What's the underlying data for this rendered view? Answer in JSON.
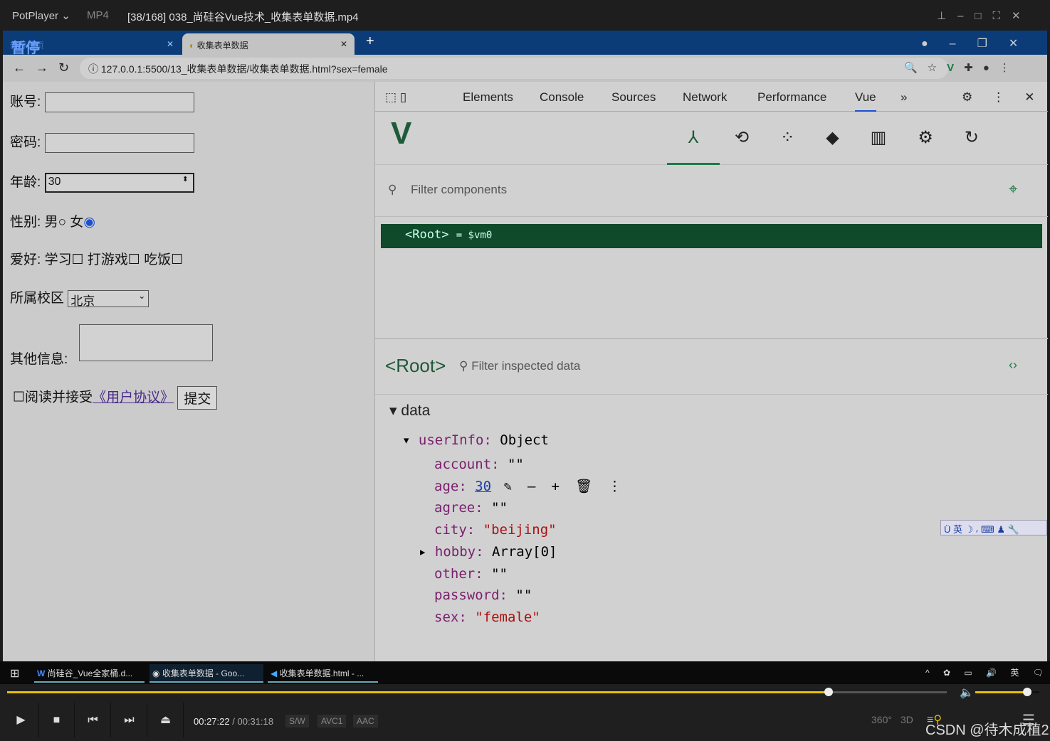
{
  "player": {
    "app": "PotPlayer",
    "format": "MP4",
    "file_title": "[38/168] 038_尚硅谷Vue技术_收集表单数据.mp4",
    "paused_label": "暂停",
    "time_current": "00:27:22",
    "time_sep": "/",
    "time_total": "00:31:18",
    "badges": [
      "S/W",
      "AVC1",
      "AAC"
    ],
    "extra_buttons": [
      "360°",
      "3D"
    ],
    "progress_percent": 87.4,
    "volume_percent": 81,
    "watermark": "CSDN @待木成植2",
    "accent": "#e6c200"
  },
  "browser": {
    "tabs": [
      {
        "label": "新标签页"
      },
      {
        "label": "收集表单数据",
        "active": true
      }
    ],
    "url": "127.0.0.1:5500/13_收集表单数据/收集表单数据.html?sex=female"
  },
  "form": {
    "account_label": "账号:",
    "password_label": "密码:",
    "age_label": "年龄:",
    "age_value": "30",
    "sex_label": "性别:",
    "male": "男",
    "female": "女",
    "sex_selected": "female",
    "hobby_label": "爱好:",
    "hobbies": [
      "学习",
      "打游戏",
      "吃饭"
    ],
    "campus_label": "所属校区",
    "campus_value": "北京",
    "other_label": "其他信息:",
    "agree_text": "阅读并接受",
    "agreement_link": "《用户协议》",
    "submit": "提交"
  },
  "devtools": {
    "tabs": [
      "Elements",
      "Console",
      "Sources",
      "Network",
      "Performance",
      "Vue"
    ],
    "active_tab": "Vue",
    "filter_components_placeholder": "Filter components",
    "root_node": "Root",
    "root_var": "= $vm0",
    "inspector_title": "Root",
    "filter_data_placeholder": "Filter inspected data",
    "section": "data",
    "userInfo": {
      "key": "userInfo:",
      "type": "Object",
      "props": [
        {
          "key": "account:",
          "value": "\"\"",
          "kind": "str"
        },
        {
          "key": "age:",
          "value": "30",
          "kind": "num"
        },
        {
          "key": "agree:",
          "value": "\"\"",
          "kind": "str"
        },
        {
          "key": "city:",
          "value": "\"beijing\"",
          "kind": "str"
        },
        {
          "key": "hobby:",
          "value": "Array[0]",
          "kind": "obj"
        },
        {
          "key": "other:",
          "value": "\"\"",
          "kind": "str"
        },
        {
          "key": "password:",
          "value": "\"\"",
          "kind": "str"
        },
        {
          "key": "sex:",
          "value": "\"female\"",
          "kind": "str"
        }
      ]
    }
  },
  "ime": {
    "label": "英"
  },
  "taskbar": {
    "items": [
      "尚硅谷_Vue全家桶.d...",
      "收集表单数据 - Goo...",
      "收集表单数据.html - ..."
    ],
    "tray_lang": "英"
  }
}
